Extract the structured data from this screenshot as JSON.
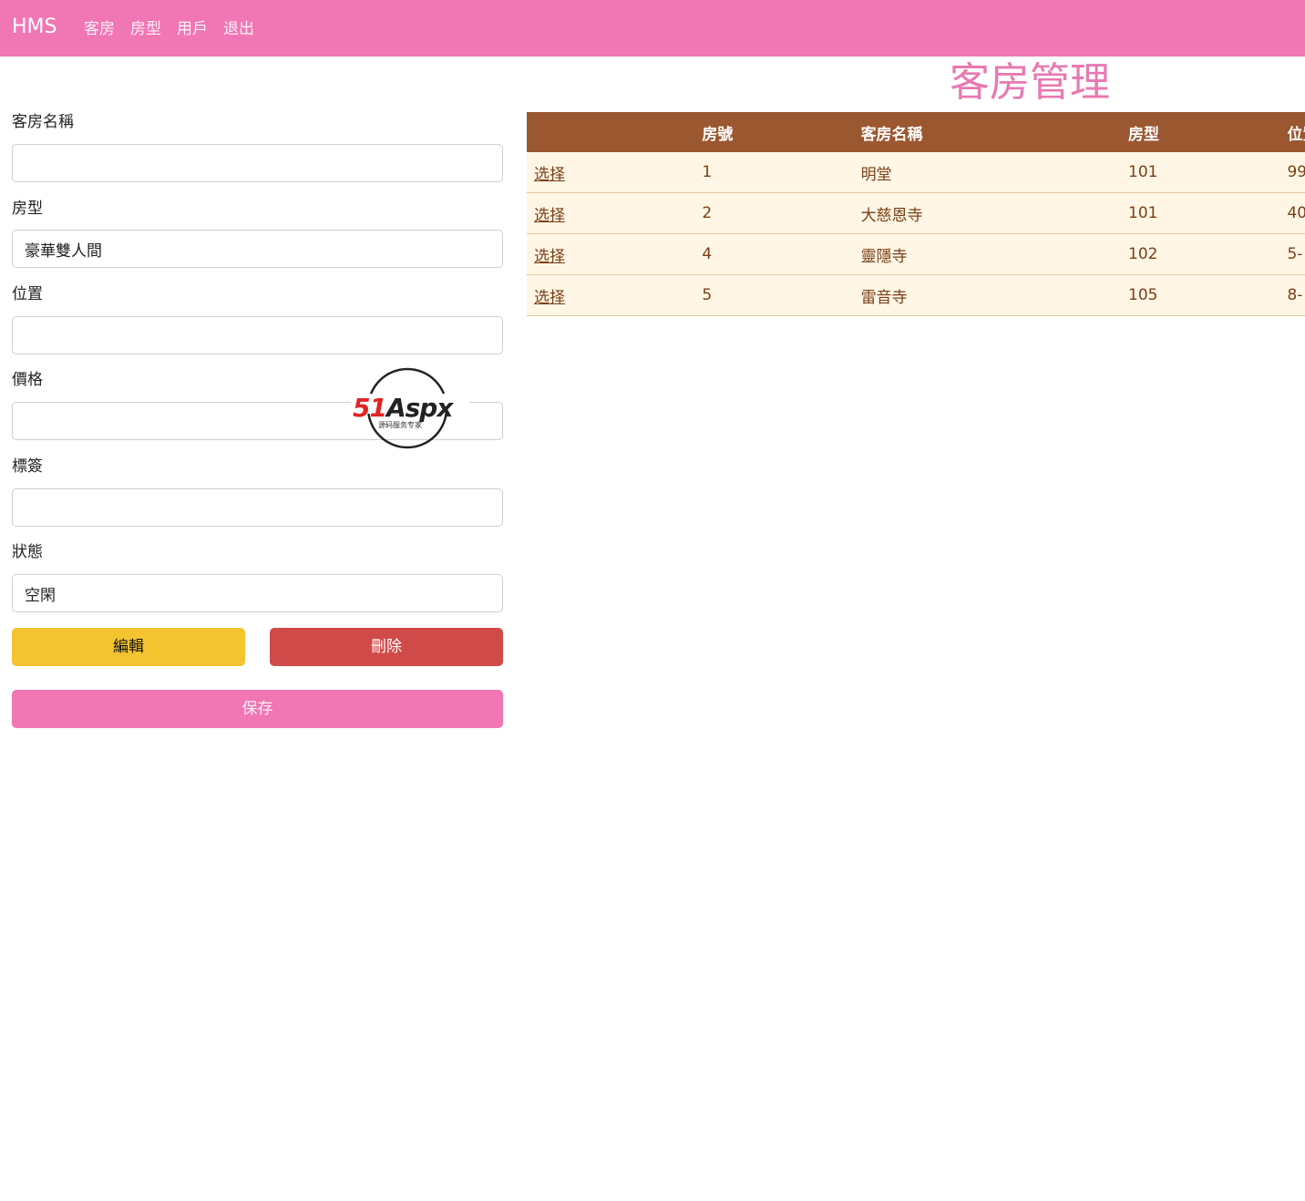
{
  "navbar": {
    "brand": "HMS",
    "links": [
      "客房",
      "房型",
      "用戶",
      "退出"
    ]
  },
  "page": {
    "title": "客房管理"
  },
  "form": {
    "fields": [
      {
        "label": "客房名稱",
        "value": ""
      },
      {
        "label": "房型",
        "value": "豪華雙人間"
      },
      {
        "label": "位置",
        "value": ""
      },
      {
        "label": "價格",
        "value": ""
      },
      {
        "label": "標簽",
        "value": ""
      },
      {
        "label": "狀態",
        "value": "空閑"
      }
    ],
    "edit_label": "編輯",
    "delete_label": "刪除",
    "save_label": "保存"
  },
  "watermark": {
    "brand_text": "51Aspx",
    "tagline": "源码服务专家"
  },
  "table": {
    "headers": [
      "",
      "房號",
      "客房名稱",
      "房型",
      "位置"
    ],
    "rows": [
      {
        "action": "选择",
        "room_no": "1",
        "name": "明堂",
        "type": "101",
        "location": "99"
      },
      {
        "action": "选择",
        "room_no": "2",
        "name": "大慈恩寺",
        "type": "101",
        "location": "40"
      },
      {
        "action": "选择",
        "room_no": "4",
        "name": "靈隱寺",
        "type": "102",
        "location": "5-"
      },
      {
        "action": "选择",
        "room_no": "5",
        "name": "雷音寺",
        "type": "105",
        "location": "8-"
      }
    ]
  },
  "colors": {
    "navbar": "#f176b4",
    "title": "#e978b0",
    "table_header": "#9b5730",
    "table_row": "#fff6e6",
    "edit_button": "#f4c430",
    "delete_button": "#d14a4a",
    "save_button": "#f176b4"
  }
}
